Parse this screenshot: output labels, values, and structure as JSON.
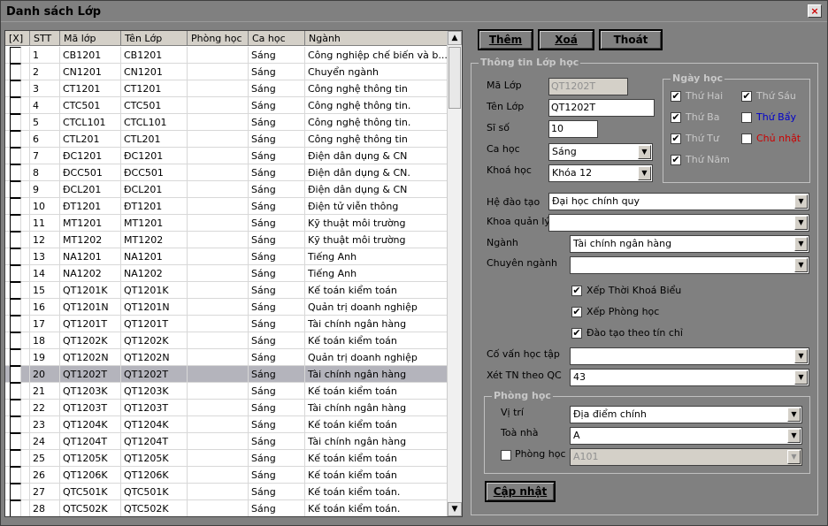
{
  "window": {
    "title": "Danh sách Lớp",
    "close_glyph": "×"
  },
  "grid": {
    "columns": [
      "[X]",
      "STT",
      "Mã lớp",
      "Tên Lớp",
      "Phòng học",
      "Ca học",
      "Ngành"
    ],
    "selected_index": 19,
    "rows": [
      {
        "stt": "1",
        "ma": "CB1201",
        "ten": "CB1201",
        "phong": "",
        "ca": "Sáng",
        "nganh": "Công nghiệp chế biến và b..."
      },
      {
        "stt": "2",
        "ma": "CN1201",
        "ten": "CN1201",
        "phong": "",
        "ca": "Sáng",
        "nganh": "Chuyển ngành"
      },
      {
        "stt": "3",
        "ma": "CT1201",
        "ten": "CT1201",
        "phong": "",
        "ca": "Sáng",
        "nganh": "Công nghệ thông tin"
      },
      {
        "stt": "4",
        "ma": "CTC501",
        "ten": "CTC501",
        "phong": "",
        "ca": "Sáng",
        "nganh": "Công nghệ thông tin."
      },
      {
        "stt": "5",
        "ma": "CTCL101",
        "ten": "CTCL101",
        "phong": "",
        "ca": "Sáng",
        "nganh": "Công nghệ thông tin."
      },
      {
        "stt": "6",
        "ma": "CTL201",
        "ten": "CTL201",
        "phong": "",
        "ca": "Sáng",
        "nganh": "Công nghệ thông tin"
      },
      {
        "stt": "7",
        "ma": "ĐC1201",
        "ten": "ĐC1201",
        "phong": "",
        "ca": "Sáng",
        "nganh": "Điện dân dụng & CN"
      },
      {
        "stt": "8",
        "ma": "ĐCC501",
        "ten": "ĐCC501",
        "phong": "",
        "ca": "Sáng",
        "nganh": "Điện dân dụng & CN."
      },
      {
        "stt": "9",
        "ma": "ĐCL201",
        "ten": "ĐCL201",
        "phong": "",
        "ca": "Sáng",
        "nganh": "Điện dân dụng & CN"
      },
      {
        "stt": "10",
        "ma": "ĐT1201",
        "ten": "ĐT1201",
        "phong": "",
        "ca": "Sáng",
        "nganh": "Điện tử viễn thông"
      },
      {
        "stt": "11",
        "ma": "MT1201",
        "ten": "MT1201",
        "phong": "",
        "ca": "Sáng",
        "nganh": "Kỹ thuật môi trường"
      },
      {
        "stt": "12",
        "ma": "MT1202",
        "ten": "MT1202",
        "phong": "",
        "ca": "Sáng",
        "nganh": "Kỹ thuật môi trường"
      },
      {
        "stt": "13",
        "ma": "NA1201",
        "ten": "NA1201",
        "phong": "",
        "ca": "Sáng",
        "nganh": "Tiếng Anh"
      },
      {
        "stt": "14",
        "ma": "NA1202",
        "ten": "NA1202",
        "phong": "",
        "ca": "Sáng",
        "nganh": "Tiếng Anh"
      },
      {
        "stt": "15",
        "ma": "QT1201K",
        "ten": "QT1201K",
        "phong": "",
        "ca": "Sáng",
        "nganh": "Kế toán kiểm toán"
      },
      {
        "stt": "16",
        "ma": "QT1201N",
        "ten": "QT1201N",
        "phong": "",
        "ca": "Sáng",
        "nganh": "Quản trị doanh nghiệp"
      },
      {
        "stt": "17",
        "ma": "QT1201T",
        "ten": "QT1201T",
        "phong": "",
        "ca": "Sáng",
        "nganh": "Tài chính ngân hàng"
      },
      {
        "stt": "18",
        "ma": "QT1202K",
        "ten": "QT1202K",
        "phong": "",
        "ca": "Sáng",
        "nganh": "Kế toán kiểm toán"
      },
      {
        "stt": "19",
        "ma": "QT1202N",
        "ten": "QT1202N",
        "phong": "",
        "ca": "Sáng",
        "nganh": "Quản trị doanh nghiệp"
      },
      {
        "stt": "20",
        "ma": "QT1202T",
        "ten": "QT1202T",
        "phong": "",
        "ca": "Sáng",
        "nganh": "Tài chính ngân hàng"
      },
      {
        "stt": "21",
        "ma": "QT1203K",
        "ten": "QT1203K",
        "phong": "",
        "ca": "Sáng",
        "nganh": "Kế toán kiểm toán"
      },
      {
        "stt": "22",
        "ma": "QT1203T",
        "ten": "QT1203T",
        "phong": "",
        "ca": "Sáng",
        "nganh": "Tài chính ngân hàng"
      },
      {
        "stt": "23",
        "ma": "QT1204K",
        "ten": "QT1204K",
        "phong": "",
        "ca": "Sáng",
        "nganh": "Kế toán kiểm toán"
      },
      {
        "stt": "24",
        "ma": "QT1204T",
        "ten": "QT1204T",
        "phong": "",
        "ca": "Sáng",
        "nganh": "Tài chính ngân hàng"
      },
      {
        "stt": "25",
        "ma": "QT1205K",
        "ten": "QT1205K",
        "phong": "",
        "ca": "Sáng",
        "nganh": "Kế toán kiểm toán"
      },
      {
        "stt": "26",
        "ma": "QT1206K",
        "ten": "QT1206K",
        "phong": "",
        "ca": "Sáng",
        "nganh": "Kế toán kiểm toán"
      },
      {
        "stt": "27",
        "ma": "QTC501K",
        "ten": "QTC501K",
        "phong": "",
        "ca": "Sáng",
        "nganh": "Kế toán kiểm toán."
      },
      {
        "stt": "28",
        "ma": "QTC502K",
        "ten": "QTC502K",
        "phong": "",
        "ca": "Sáng",
        "nganh": "Kế toán kiểm toán."
      }
    ]
  },
  "toolbar": {
    "add": "Thêm",
    "delete": "Xoá",
    "exit": "Thoát"
  },
  "info": {
    "group_title": "Thông tin Lớp học",
    "ma_lop_label": "Mã Lớp",
    "ma_lop_value": "QT1202T",
    "ten_lop_label": "Tên Lớp",
    "ten_lop_value": "QT1202T",
    "si_so_label": "Sĩ số",
    "si_so_value": "10",
    "ca_hoc_label": "Ca học",
    "ca_hoc_value": "Sáng",
    "khoa_hoc_label": "Khoá học",
    "khoa_hoc_value": "Khóa 12",
    "he_dao_tao_label": "Hệ đào tạo",
    "he_dao_tao_value": "Đại học chính quy",
    "khoa_quan_ly_label": "Khoa quản lý",
    "khoa_quan_ly_value": "",
    "nganh_label": "Ngành",
    "nganh_value": "Tài chính ngân hàng",
    "chuyen_nganh_label": "Chuyên ngành",
    "chuyen_nganh_value": "",
    "xep_tkb": "Xếp Thời Khoá Biểu",
    "xep_phong": "Xếp Phòng học",
    "dao_tao_tin_chi": "Đào tạo theo tín chỉ",
    "co_van_label": "Cố vấn học tập",
    "co_van_value": "",
    "xet_tn_label": "Xét TN theo QC",
    "xet_tn_value": "43",
    "update": "Cập nhật"
  },
  "ngay_hoc": {
    "title": "Ngày học",
    "days": [
      {
        "label": "Thứ Hai",
        "checked": true
      },
      {
        "label": "Thứ Sáu",
        "checked": true
      },
      {
        "label": "Thứ Ba",
        "checked": true
      },
      {
        "label": "Thứ Bẩy",
        "checked": false
      },
      {
        "label": "Thứ Tư",
        "checked": true
      },
      {
        "label": "Chủ nhật",
        "checked": false
      },
      {
        "label": "Thứ Năm",
        "checked": true
      }
    ],
    "colors": {
      "weekday": "#c8c8c8",
      "saturday": "#0000cc",
      "sunday": "#cc0000"
    }
  },
  "phong_hoc": {
    "title": "Phòng học",
    "vi_tri_label": "Vị trí",
    "vi_tri_value": "Địa điểm chính",
    "toa_nha_label": "Toà nhà",
    "toa_nha_value": "A",
    "phong_label": "Phòng học",
    "phong_value": "A101"
  },
  "glyphs": {
    "check": "✔",
    "down": "▼",
    "up": "▲"
  }
}
